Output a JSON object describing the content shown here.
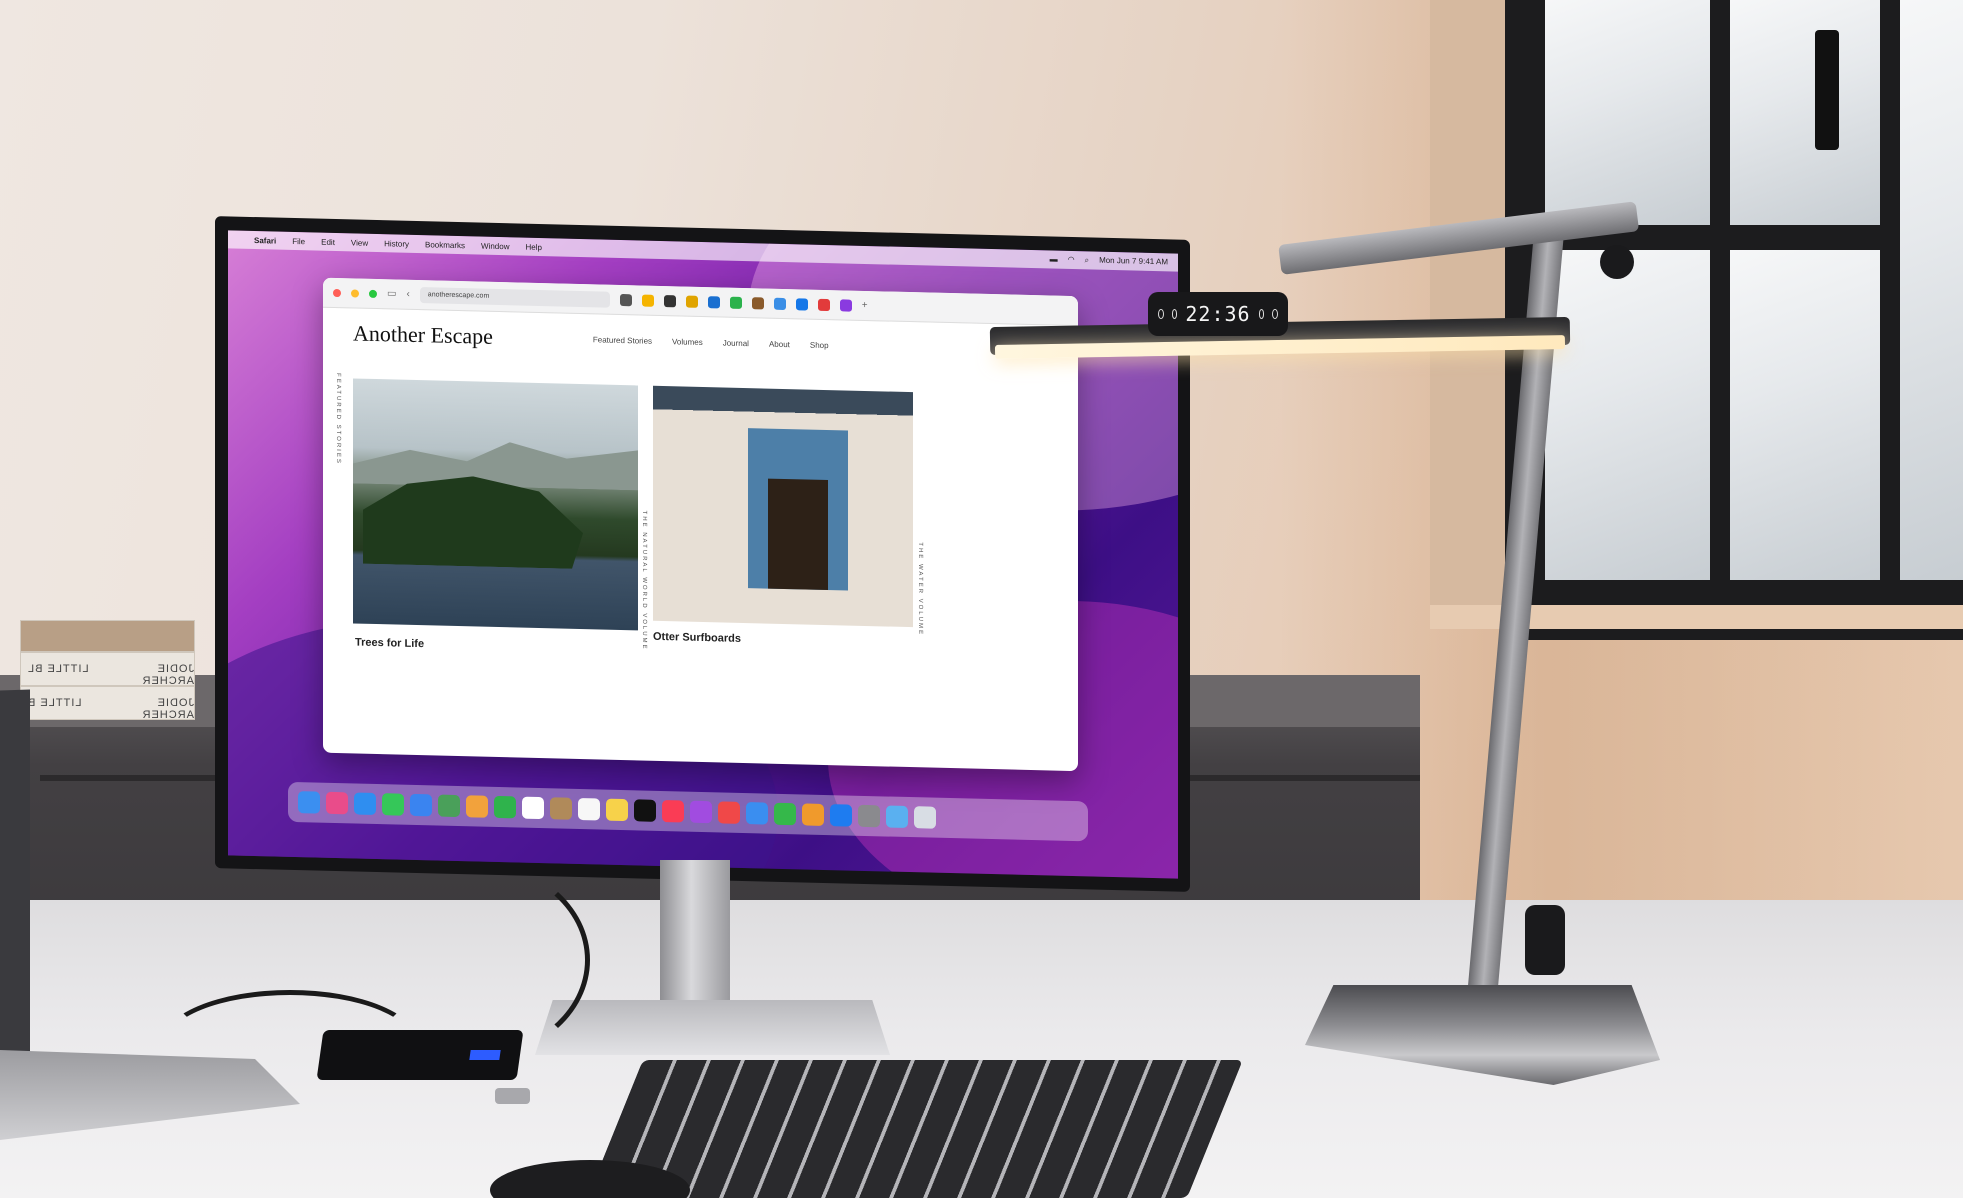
{
  "menubar": {
    "app": "Safari",
    "items": [
      "File",
      "Edit",
      "View",
      "History",
      "Bookmarks",
      "Window",
      "Help"
    ],
    "clock": "Mon Jun 7  9:41 AM"
  },
  "browser": {
    "url": "anotherescape.com"
  },
  "site": {
    "logo": "Another Escape",
    "nav": [
      "Featured Stories",
      "Volumes",
      "Journal",
      "About",
      "Shop"
    ],
    "side_label": "FEATURED STORIES",
    "side_label_2": "THE NATURAL WORLD VOLUME",
    "side_label_3": "THE WATER VOLUME",
    "stories": [
      {
        "title": "Trees for Life"
      },
      {
        "title": "Otter Surfboards"
      }
    ]
  },
  "lamp": {
    "clock": "22:36"
  },
  "books": {
    "spine_1": "LITTLE BL",
    "spine_1b": "JODIE ARCHER",
    "spine_2": "LITTLE B",
    "spine_2b": "JODIE ARCHER"
  },
  "colors": {
    "wallpaper_primary": "#a43fc2",
    "lamp_light": "#ffe9bd"
  }
}
